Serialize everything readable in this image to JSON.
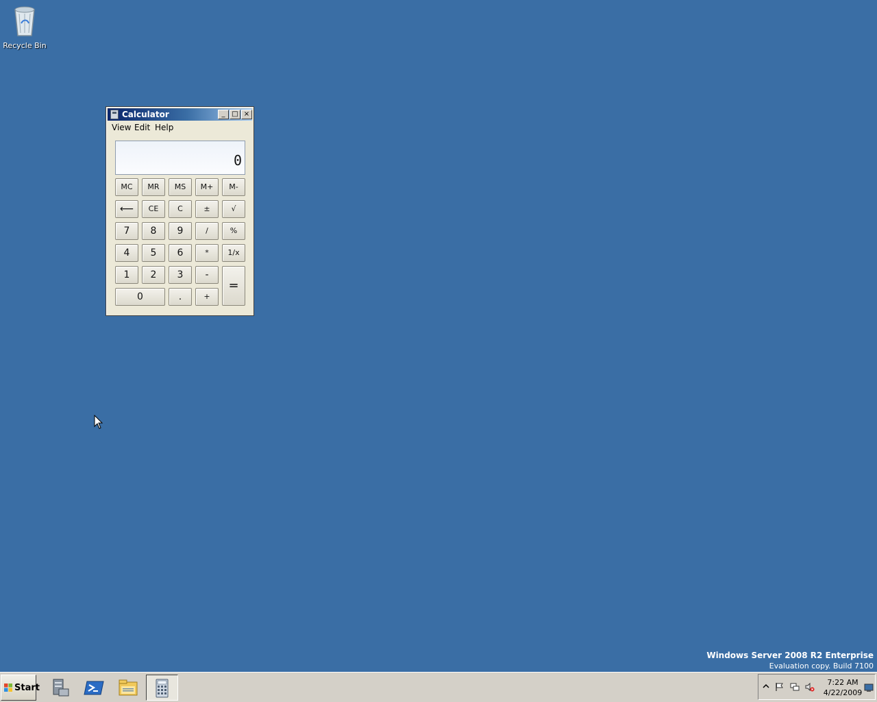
{
  "desktop": {
    "recycle_bin_label": "Recycle Bin",
    "watermark_line1": "Windows Server 2008 R2 Enterprise",
    "watermark_line2": "Evaluation copy. Build 7100"
  },
  "calculator": {
    "title": "Calculator",
    "menu": [
      "View",
      "Edit",
      "Help"
    ],
    "display_value": "0",
    "window_buttons": {
      "minimize": "_",
      "maximize": "□",
      "close": "×"
    },
    "keys": {
      "mc": "MC",
      "mr": "MR",
      "ms": "MS",
      "mplus": "M+",
      "mminus": "M-",
      "backspace": "⟵",
      "ce": "CE",
      "c": "C",
      "plusminus": "±",
      "sqrt": "√",
      "k7": "7",
      "k8": "8",
      "k9": "9",
      "divide": "/",
      "percent": "%",
      "k4": "4",
      "k5": "5",
      "k6": "6",
      "multiply": "*",
      "reciprocal": "1/x",
      "k1": "1",
      "k2": "2",
      "k3": "3",
      "minus": "-",
      "equals": "=",
      "k0": "0",
      "decimal": ".",
      "plus": "+"
    }
  },
  "taskbar": {
    "start_label": "Start",
    "apps": [
      "server-manager-icon",
      "powershell-icon",
      "explorer-icon",
      "calculator-icon"
    ],
    "clock_time": "7:22 AM",
    "clock_date": "4/22/2009",
    "tray_icons": [
      "show-hidden-icon",
      "action-center-flag-icon",
      "network-icon",
      "volume-muted-icon",
      "show-desktop-icon"
    ]
  },
  "colors": {
    "desktop": "#3a6ea5",
    "title_start": "#0a246a",
    "title_end": "#a6caf0"
  }
}
